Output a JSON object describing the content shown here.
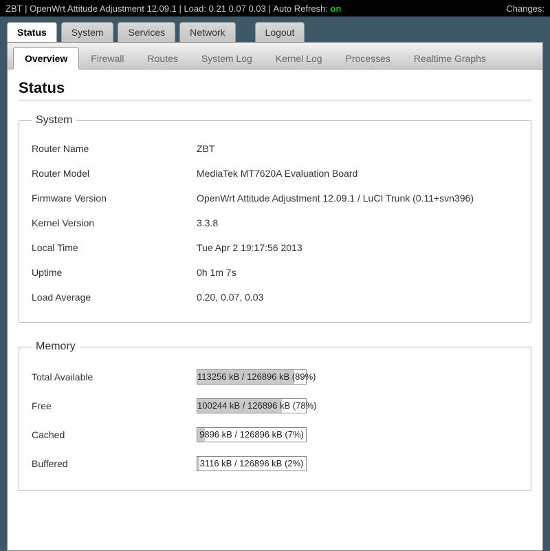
{
  "topbar": {
    "hostname": "ZBT",
    "firmware": "OpenWrt Attitude Adjustment 12.09.1",
    "load_label": "Load:",
    "load": "0.21 0.07 0.03",
    "autorefresh_label": "Auto Refresh:",
    "autorefresh_state": "on",
    "changes_label": "Changes:"
  },
  "main_tabs": {
    "status": "Status",
    "system": "System",
    "services": "Services",
    "network": "Network",
    "logout": "Logout"
  },
  "sub_tabs": {
    "overview": "Overview",
    "firewall": "Firewall",
    "routes": "Routes",
    "system_log": "System Log",
    "kernel_log": "Kernel Log",
    "processes": "Processes",
    "realtime_graphs": "Realtime Graphs"
  },
  "page": {
    "title": "Status"
  },
  "system_section": {
    "legend": "System",
    "rows": {
      "router_name": {
        "label": "Router Name",
        "value": "ZBT"
      },
      "router_model": {
        "label": "Router Model",
        "value": "MediaTek MT7620A Evaluation Board"
      },
      "firmware_version": {
        "label": "Firmware Version",
        "value": "OpenWrt Attitude Adjustment 12.09.1 / LuCI Trunk (0.11+svn396)"
      },
      "kernel_version": {
        "label": "Kernel Version",
        "value": "3.3.8"
      },
      "local_time": {
        "label": "Local Time",
        "value": "Tue Apr 2 19:17:56 2013"
      },
      "uptime": {
        "label": "Uptime",
        "value": "0h 1m 7s"
      },
      "load_average": {
        "label": "Load Average",
        "value": "0.20, 0.07, 0.03"
      }
    }
  },
  "memory_section": {
    "legend": "Memory",
    "rows": {
      "total_available": {
        "label": "Total Available",
        "text": "113256 kB / 126896 kB (89%)",
        "percent": 89
      },
      "free": {
        "label": "Free",
        "text": "100244 kB / 126896 kB (78%)",
        "percent": 78
      },
      "cached": {
        "label": "Cached",
        "text": "9896 kB / 126896 kB (7%)",
        "percent": 7
      },
      "buffered": {
        "label": "Buffered",
        "text": "3116 kB / 126896 kB (2%)",
        "percent": 2
      }
    }
  }
}
